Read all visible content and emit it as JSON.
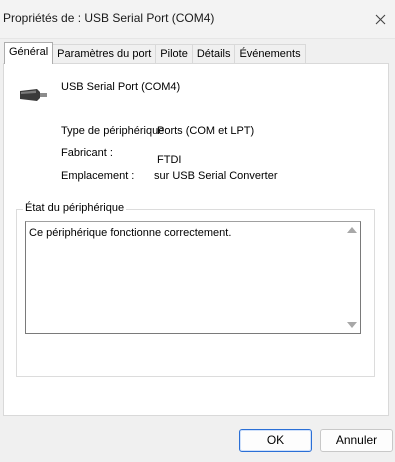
{
  "window": {
    "title": "Propriétés de : USB Serial Port (COM4)"
  },
  "tabs": [
    {
      "label": "Général",
      "active": true
    },
    {
      "label": "Paramètres du port",
      "active": false
    },
    {
      "label": "Pilote",
      "active": false
    },
    {
      "label": "Détails",
      "active": false
    },
    {
      "label": "Événements",
      "active": false
    }
  ],
  "device": {
    "name": "USB Serial Port (COM4)",
    "icon": "usb-serial-connector-icon",
    "type_label": "Type de périphérique",
    "type_value": "Ports (COM et LPT)",
    "manufacturer_label": "Fabricant :",
    "manufacturer_value": "FTDI",
    "location_label": "Emplacement :",
    "location_value": "sur USB Serial Converter"
  },
  "status": {
    "group_title": "État du périphérique",
    "text": "Ce périphérique fonctionne correctement."
  },
  "buttons": {
    "ok": "OK",
    "cancel": "Annuler"
  },
  "colors": {
    "primary_button_border": "#2a6fd6"
  }
}
